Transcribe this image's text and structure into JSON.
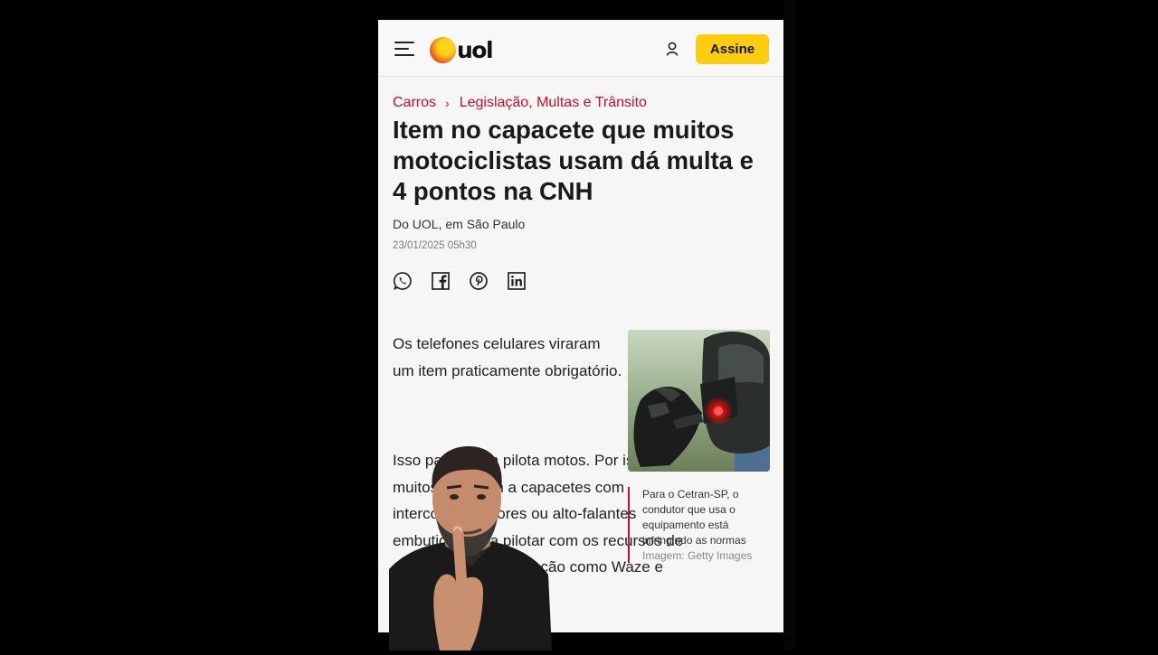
{
  "header": {
    "logo_text": "uol",
    "subscribe_label": "Assine",
    "menu_icon": "hamburger-menu-icon",
    "user_icon": "user-icon",
    "accent_color": "#ffcc0e"
  },
  "breadcrumb": {
    "section": "Carros",
    "separator": "›",
    "subsection": "Legislação, Multas e Trânsito",
    "color": "#c8102e"
  },
  "article": {
    "headline": "Item no capacete que muitos motociclistas usam dá multa e 4 pontos na CNH",
    "byline": "Do UOL, em São Paulo",
    "date": "23/01/2025 05h30",
    "share_icons": [
      "whatsapp-icon",
      "facebook-icon",
      "pinterest-icon",
      "linkedin-icon"
    ],
    "paragraph_1": "Os telefones celulares viraram um item praticamente obrigatório.",
    "paragraph_2": "Isso para quem pilota motos. Por isso, muitos recorrem a capacetes com intercomunicadores ou alto-falantes embutidos para pilotar com os recursos de aplicativos de navegação como Waze e Google Maps.",
    "image": {
      "caption": "Para o Cetran-SP, o condutor que usa o equipamento está infringindo as normas",
      "credit": "Imagem: Getty Images"
    }
  }
}
